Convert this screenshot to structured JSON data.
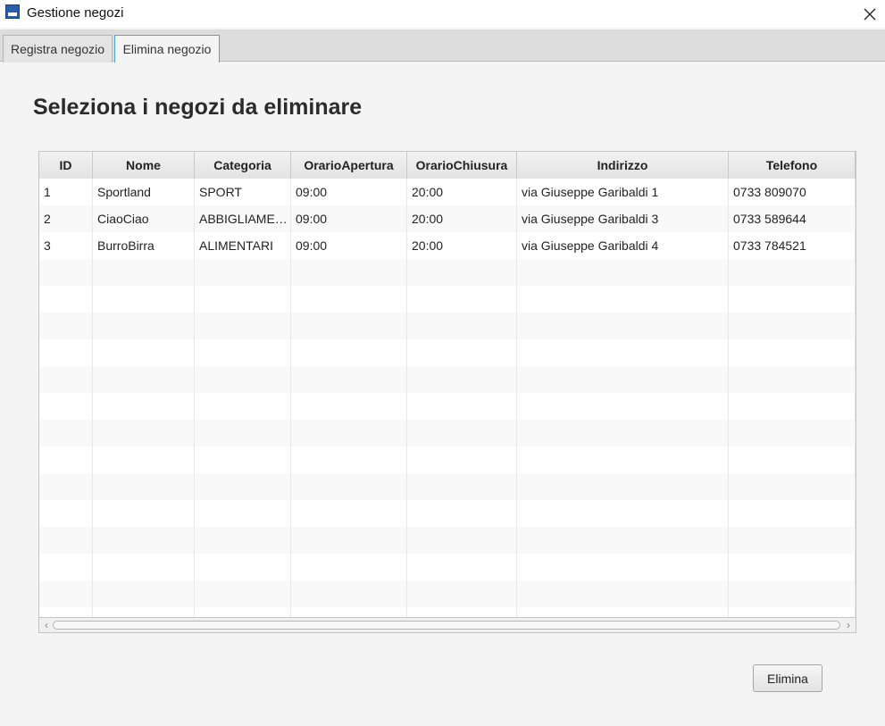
{
  "window": {
    "title": "Gestione negozi"
  },
  "tabs": [
    {
      "label": "Registra negozio"
    },
    {
      "label": "Elimina negozio"
    }
  ],
  "main": {
    "title": "Seleziona i negozi da eliminare",
    "delete_button": "Elimina"
  },
  "table": {
    "columns": [
      "ID",
      "Nome",
      "Categoria",
      "OrarioApertura",
      "OrarioChiusura",
      "Indirizzo",
      "Telefono"
    ],
    "rows": [
      [
        "1",
        "Sportland",
        "SPORT",
        "09:00",
        "20:00",
        "via Giuseppe Garibaldi 1",
        "0733 809070"
      ],
      [
        "2",
        "CiaoCiao",
        "ABBIGLIAME…",
        "09:00",
        "20:00",
        "via Giuseppe Garibaldi 3",
        "0733 589644"
      ],
      [
        "3",
        "BurroBirra",
        "ALIMENTARI",
        "09:00",
        "20:00",
        "via Giuseppe Garibaldi 4",
        "0733 784521"
      ]
    ]
  },
  "icons": {
    "app": "app-icon",
    "close": "close-icon",
    "scroll_left": "chevron-left-icon",
    "scroll_right": "chevron-right-icon"
  }
}
